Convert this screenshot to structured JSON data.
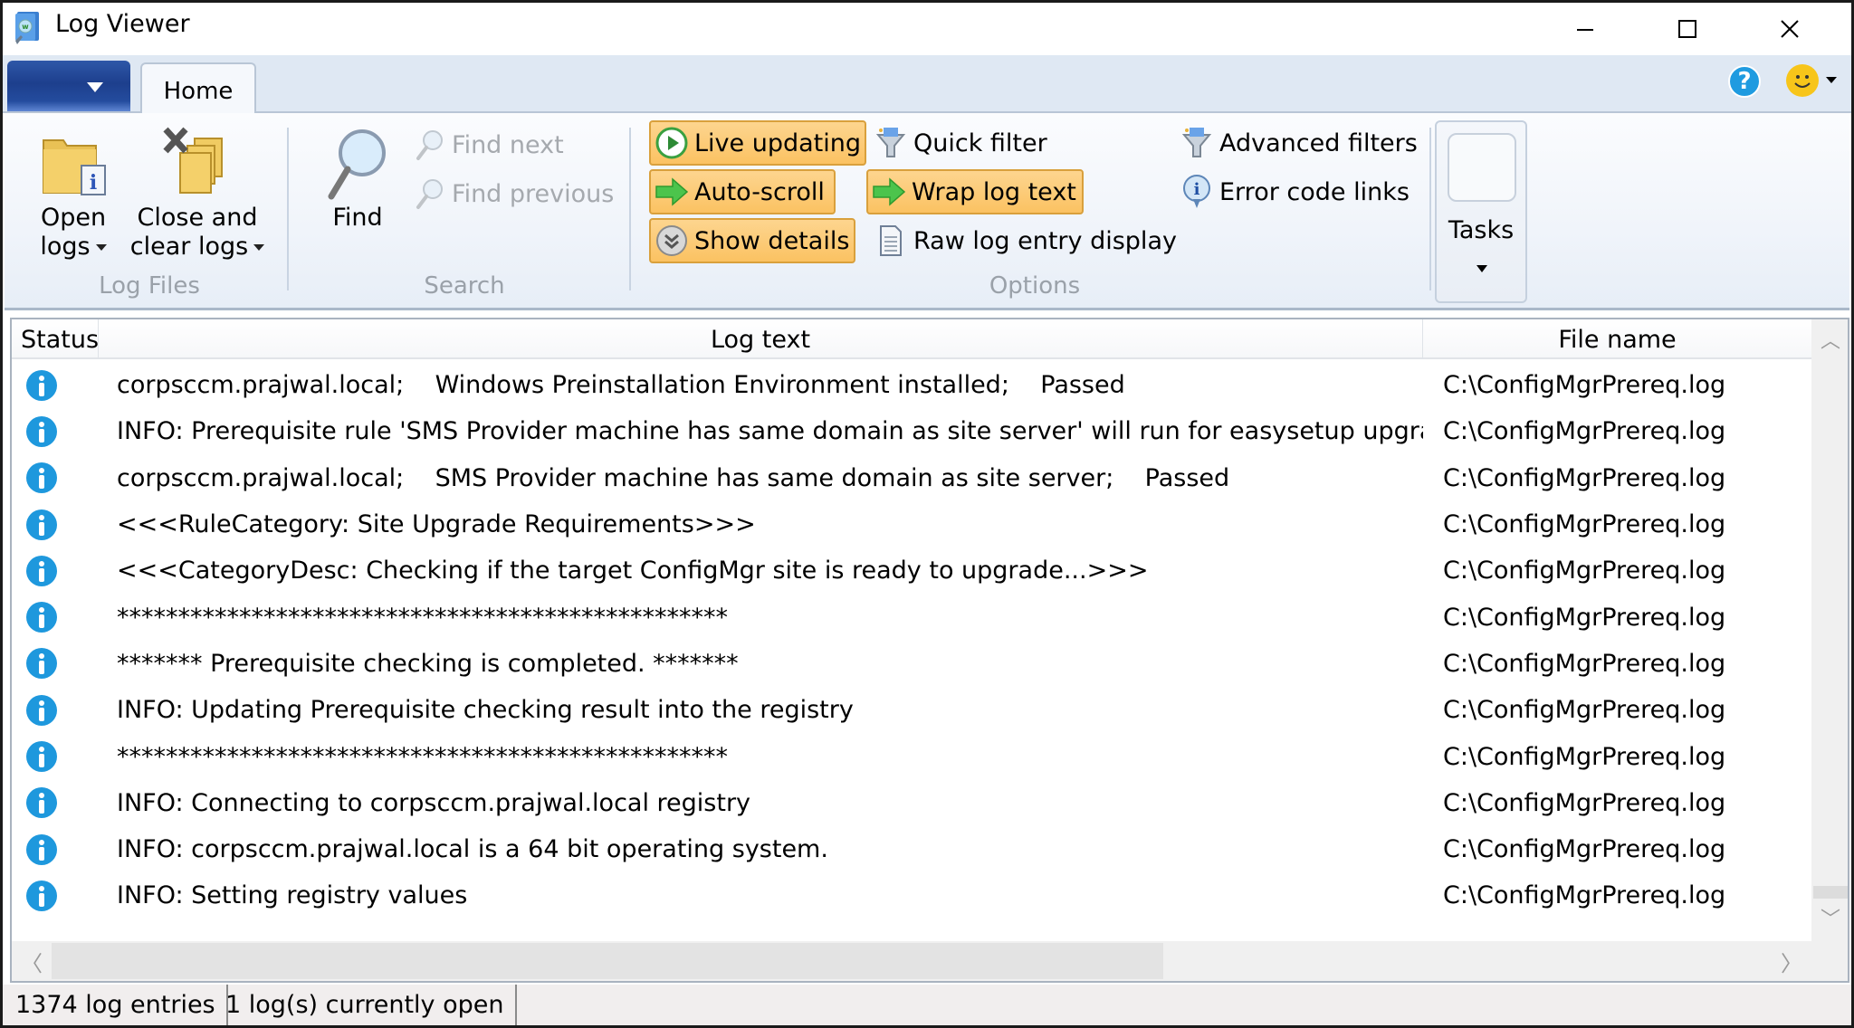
{
  "window": {
    "title": "Log Viewer",
    "controls": {
      "minimize": "minimize",
      "maximize": "maximize",
      "close": "close"
    }
  },
  "ribbon": {
    "tabs": [
      {
        "label": "Home",
        "active": true
      }
    ],
    "groups": {
      "log_files": {
        "label": "Log Files",
        "open_logs": {
          "line1": "Open",
          "line2": "logs"
        },
        "close_logs": {
          "line1": "Close and",
          "line2": "clear logs"
        }
      },
      "search": {
        "label": "Search",
        "find": "Find",
        "find_next": "Find next",
        "find_previous": "Find previous"
      },
      "options": {
        "label": "Options",
        "live_updating": "Live updating",
        "auto_scroll": "Auto-scroll",
        "show_details": "Show details",
        "quick_filter": "Quick filter",
        "wrap_log_text": "Wrap log text",
        "raw_log_entry_display": "Raw log entry display",
        "advanced_filters": "Advanced filters",
        "error_code_links": "Error code links"
      },
      "tasks": {
        "label": "Tasks"
      }
    },
    "toggle_states": {
      "live_updating": true,
      "auto_scroll": true,
      "show_details": true,
      "wrap_log_text": true,
      "raw_log_entry_display": false
    },
    "colors": {
      "active_toggle": "#fbc262",
      "app_menu": "#1d3f8d",
      "help": "#1f9be0",
      "smiley": "#f7c51a"
    }
  },
  "grid": {
    "columns": [
      "Status",
      "Log text",
      "File name"
    ],
    "rows": [
      {
        "status": "info",
        "text": "corpsccm.prajwal.local;    Windows Preinstallation Environment installed;    Passed",
        "file": "C:\\ConfigMgrPrereq.log"
      },
      {
        "status": "info",
        "text": "INFO: Prerequisite rule 'SMS Provider machine has same domain as site server' will run for easysetup upgrade.",
        "file": "C:\\ConfigMgrPrereq.log"
      },
      {
        "status": "info",
        "text": "corpsccm.prajwal.local;    SMS Provider machine has same domain as site server;    Passed",
        "file": "C:\\ConfigMgrPrereq.log"
      },
      {
        "status": "info",
        "text": "<<<RuleCategory: Site Upgrade Requirements>>>",
        "file": "C:\\ConfigMgrPrereq.log"
      },
      {
        "status": "info",
        "text": "<<<CategoryDesc: Checking if the target ConfigMgr site is ready to upgrade...>>>",
        "file": "C:\\ConfigMgrPrereq.log"
      },
      {
        "status": "info",
        "text": "**************************************************",
        "file": "C:\\ConfigMgrPrereq.log"
      },
      {
        "status": "info",
        "text": "******* Prerequisite checking is completed. *******",
        "file": "C:\\ConfigMgrPrereq.log"
      },
      {
        "status": "info",
        "text": "INFO: Updating Prerequisite checking result into the registry",
        "file": "C:\\ConfigMgrPrereq.log"
      },
      {
        "status": "info",
        "text": "**************************************************",
        "file": "C:\\ConfigMgrPrereq.log"
      },
      {
        "status": "info",
        "text": "INFO: Connecting to corpsccm.prajwal.local registry",
        "file": "C:\\ConfigMgrPrereq.log"
      },
      {
        "status": "info",
        "text": "INFO: corpsccm.prajwal.local is a 64 bit operating system.",
        "file": "C:\\ConfigMgrPrereq.log"
      },
      {
        "status": "info",
        "text": "INFO: Setting registry values",
        "file": "C:\\ConfigMgrPrereq.log"
      }
    ],
    "status_icon_color": "#1e98dd",
    "vertical_scroll_position": 1.0,
    "horizontal_scroll_position": 0.0
  },
  "statusbar": {
    "entries": "1374 log entries",
    "open_logs": "1 log(s) currently open"
  }
}
